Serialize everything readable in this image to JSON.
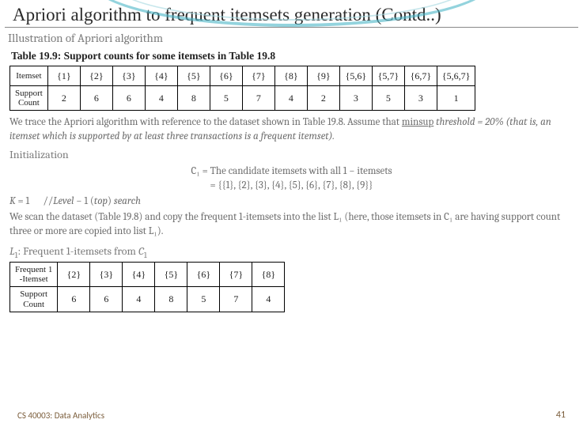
{
  "title": "Apriori algorithm to frequent itemsets generation (Contd..)",
  "illustration_heading": "Illustration of Apriori algorithm",
  "table1_caption": "Table 19.9: Support counts for some itemsets in Table 19.8",
  "table1": {
    "row1_label": "Itemset",
    "row2_label_a": "Support",
    "row2_label_b": "Count",
    "headers": [
      "{1}",
      "{2}",
      "{3}",
      "{4}",
      "{5}",
      "{6}",
      "{7}",
      "{8}",
      "{9}",
      "{5,6}",
      "{5,7}",
      "{6,7}",
      "{5,6,7}"
    ],
    "values": [
      "2",
      "6",
      "6",
      "4",
      "8",
      "5",
      "7",
      "4",
      "2",
      "3",
      "5",
      "3",
      "1"
    ]
  },
  "para1a": "We trace the Apriori algorithm with reference to the dataset shown in Table 19.8. Assume that ",
  "para1b": "minsup",
  "para1c": " threshold = 20% (that is, an itemset which is supported by at least three transactions is a frequent itemset).",
  "init_heading": "Initialization",
  "c1_line1": "C₁ = The candidate itemsets with all 1 − itemsets",
  "c1_line2": "= {{1}, {2}, {3}, {4}, {5}, {6}, {7}, {8}, {9}}",
  "k_line": "K = 1      //Level − 1 (top) search",
  "para2a": "We scan the dataset (Table 19.8) and copy the frequent 1-itemsets into the list L₁ (here, those itemsets in C₁ are having support count three or more are copied into list L₁).",
  "l1_heading": "L₁: Frequent 1-itemsets from C₁",
  "table2": {
    "row1_label_a": "Frequent 1",
    "row1_label_b": "-Itemset",
    "row2_label_a": "Support",
    "row2_label_b": "Count",
    "headers": [
      "{2}",
      "{3}",
      "{4}",
      "{5}",
      "{6}",
      "{7}",
      "{8}"
    ],
    "values": [
      "6",
      "6",
      "4",
      "8",
      "5",
      "7",
      "4"
    ]
  },
  "footer_left": "CS 40003: Data Analytics",
  "footer_right": "41",
  "chart_data": [
    {
      "type": "table",
      "title": "Table 19.9: Support counts for some itemsets in Table 19.8",
      "columns": [
        "Itemset",
        "Support Count"
      ],
      "rows": [
        [
          "{1}",
          2
        ],
        [
          "{2}",
          6
        ],
        [
          "{3}",
          6
        ],
        [
          "{4}",
          4
        ],
        [
          "{5}",
          8
        ],
        [
          "{6}",
          5
        ],
        [
          "{7}",
          7
        ],
        [
          "{8}",
          4
        ],
        [
          "{9}",
          2
        ],
        [
          "{5,6}",
          3
        ],
        [
          "{5,7}",
          5
        ],
        [
          "{6,7}",
          3
        ],
        [
          "{5,6,7}",
          1
        ]
      ]
    },
    {
      "type": "table",
      "title": "L1: Frequent 1-itemsets from C1",
      "columns": [
        "Frequent 1-Itemset",
        "Support Count"
      ],
      "rows": [
        [
          "{2}",
          6
        ],
        [
          "{3}",
          6
        ],
        [
          "{4}",
          4
        ],
        [
          "{5}",
          8
        ],
        [
          "{6}",
          5
        ],
        [
          "{7}",
          7
        ],
        [
          "{8}",
          4
        ]
      ]
    }
  ]
}
